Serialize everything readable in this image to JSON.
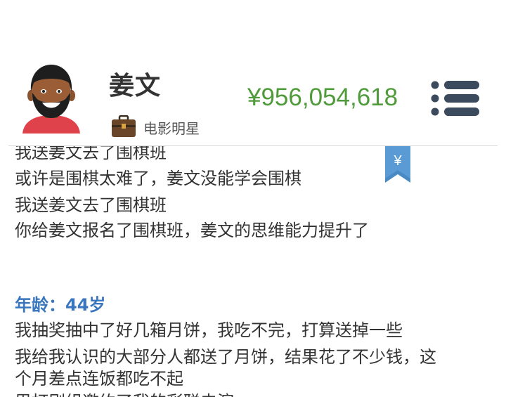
{
  "profile": {
    "name": "姜文",
    "occupation": "电影明星",
    "money": "¥956,054,618"
  },
  "bookmark": {
    "symbol": "¥"
  },
  "colors": {
    "money_green": "#4f9a3a",
    "age_blue": "#3a76be",
    "menu_dark": "#3b4a5c",
    "bookmark_blue": "#4a8ac4"
  },
  "icons": {
    "avatar": "avatar",
    "briefcase": "briefcase-icon",
    "menu": "menu-icon",
    "bookmark": "yen-bookmark-icon"
  },
  "log": {
    "lines_top": [
      "我送姜文去了围棋班",
      "或许是围棋太难了，姜文没能学会围棋",
      "我送姜文去了围棋班",
      "你给姜文报名了围棋班，姜文的思维能力提升了"
    ],
    "age_heading": "年龄：44岁",
    "lines_bottom": [
      "我抽奖抽中了好几箱月饼，我吃不完，打算送掉一些",
      "我给我认识的大部分人都送了月饼，结果花了不少钱，这",
      "个月差点连饭都吃不起",
      "思打剧组邀约了我的彩聪去演"
    ]
  }
}
